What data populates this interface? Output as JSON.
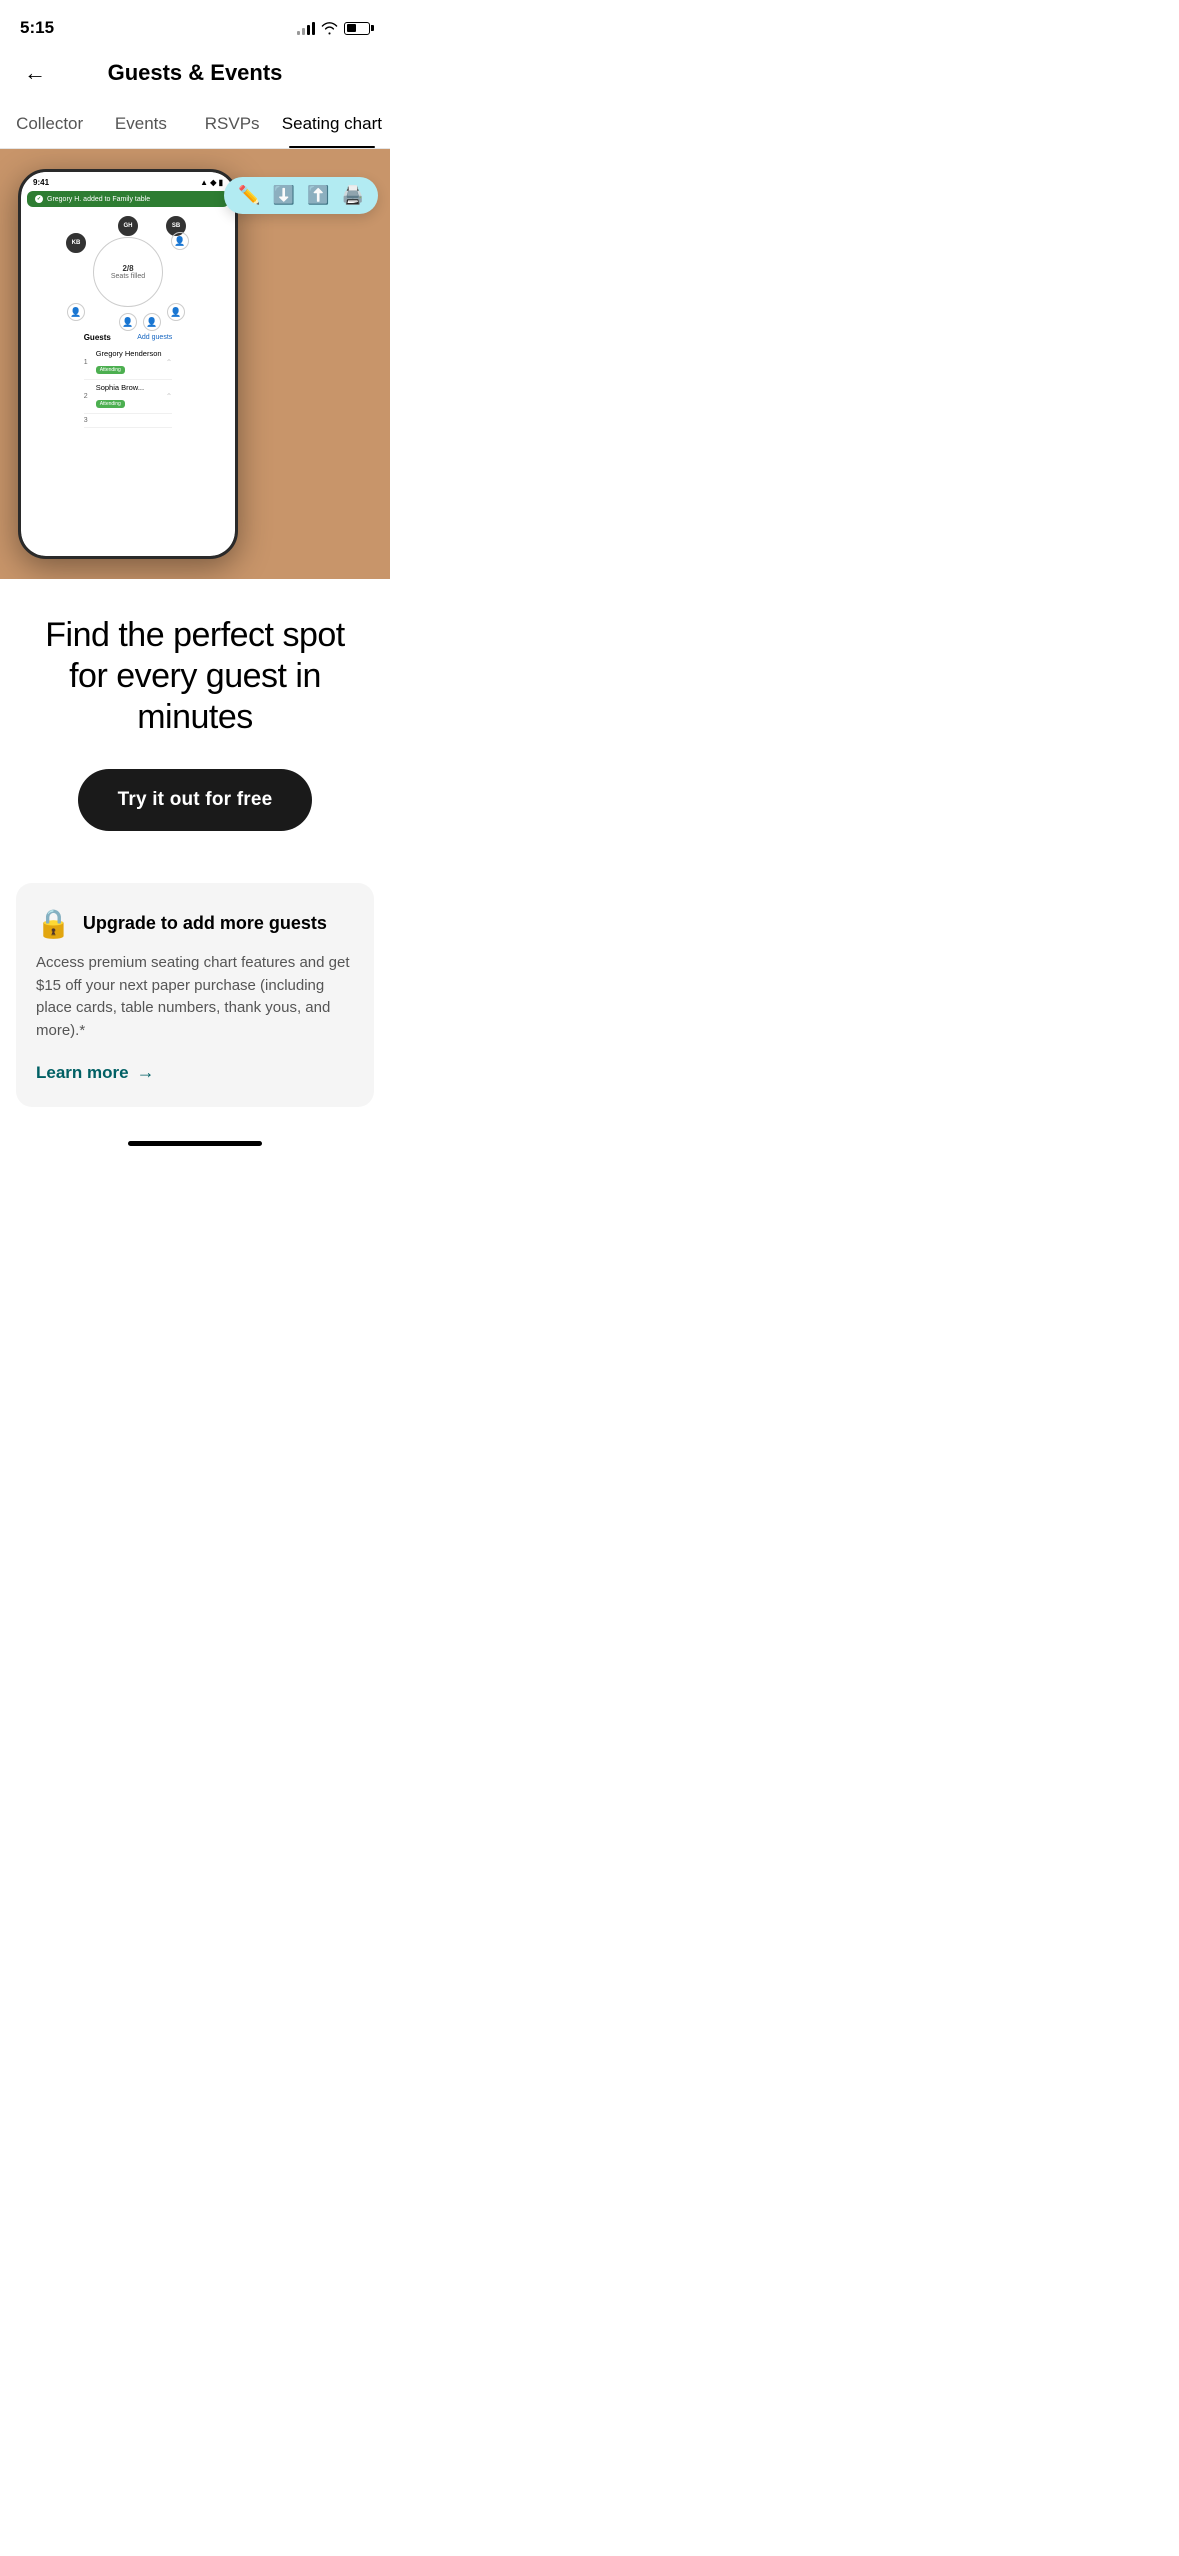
{
  "status_bar": {
    "time": "5:15",
    "signal_bars": [
      4,
      6,
      8,
      10
    ],
    "wifi": "wifi",
    "battery_level": 45
  },
  "header": {
    "title": "Guests & Events",
    "back_label": "←"
  },
  "nav": {
    "tabs": [
      {
        "label": "Collector",
        "active": false
      },
      {
        "label": "Events",
        "active": false
      },
      {
        "label": "RSVPs",
        "active": false
      },
      {
        "label": "Seating chart",
        "active": true
      }
    ]
  },
  "hero": {
    "phone_time": "9:41",
    "notification": "Gregory H. added to Family table",
    "table": {
      "seats_filled": "2/8",
      "label": "Seats filled"
    },
    "avatars": [
      {
        "initials": "GH",
        "color": "#555"
      },
      {
        "initials": "KB",
        "color": "#333"
      },
      {
        "initials": "SB",
        "color": "#444"
      }
    ],
    "guests": {
      "title": "Guests",
      "add_label": "Add guests",
      "list": [
        {
          "num": "1",
          "name": "Gregory Henderson",
          "status": "Attending"
        },
        {
          "num": "2",
          "name": "Sophia Brow...",
          "status": "Attending"
        },
        {
          "num": "3",
          "name": "",
          "status": ""
        }
      ]
    },
    "toolbar": {
      "icons": [
        "✏️",
        "⬇️",
        "⬆️",
        "🖨️"
      ]
    }
  },
  "main": {
    "headline": "Find the perfect spot for every guest in minutes",
    "cta_label": "Try it out for free"
  },
  "upgrade_card": {
    "title": "Upgrade to add more guests",
    "description": "Access premium seating chart features and get $15 off your next paper purchase (including place cards, table numbers, thank yous, and more).*",
    "learn_more_label": "Learn more",
    "learn_more_arrow": "→"
  }
}
